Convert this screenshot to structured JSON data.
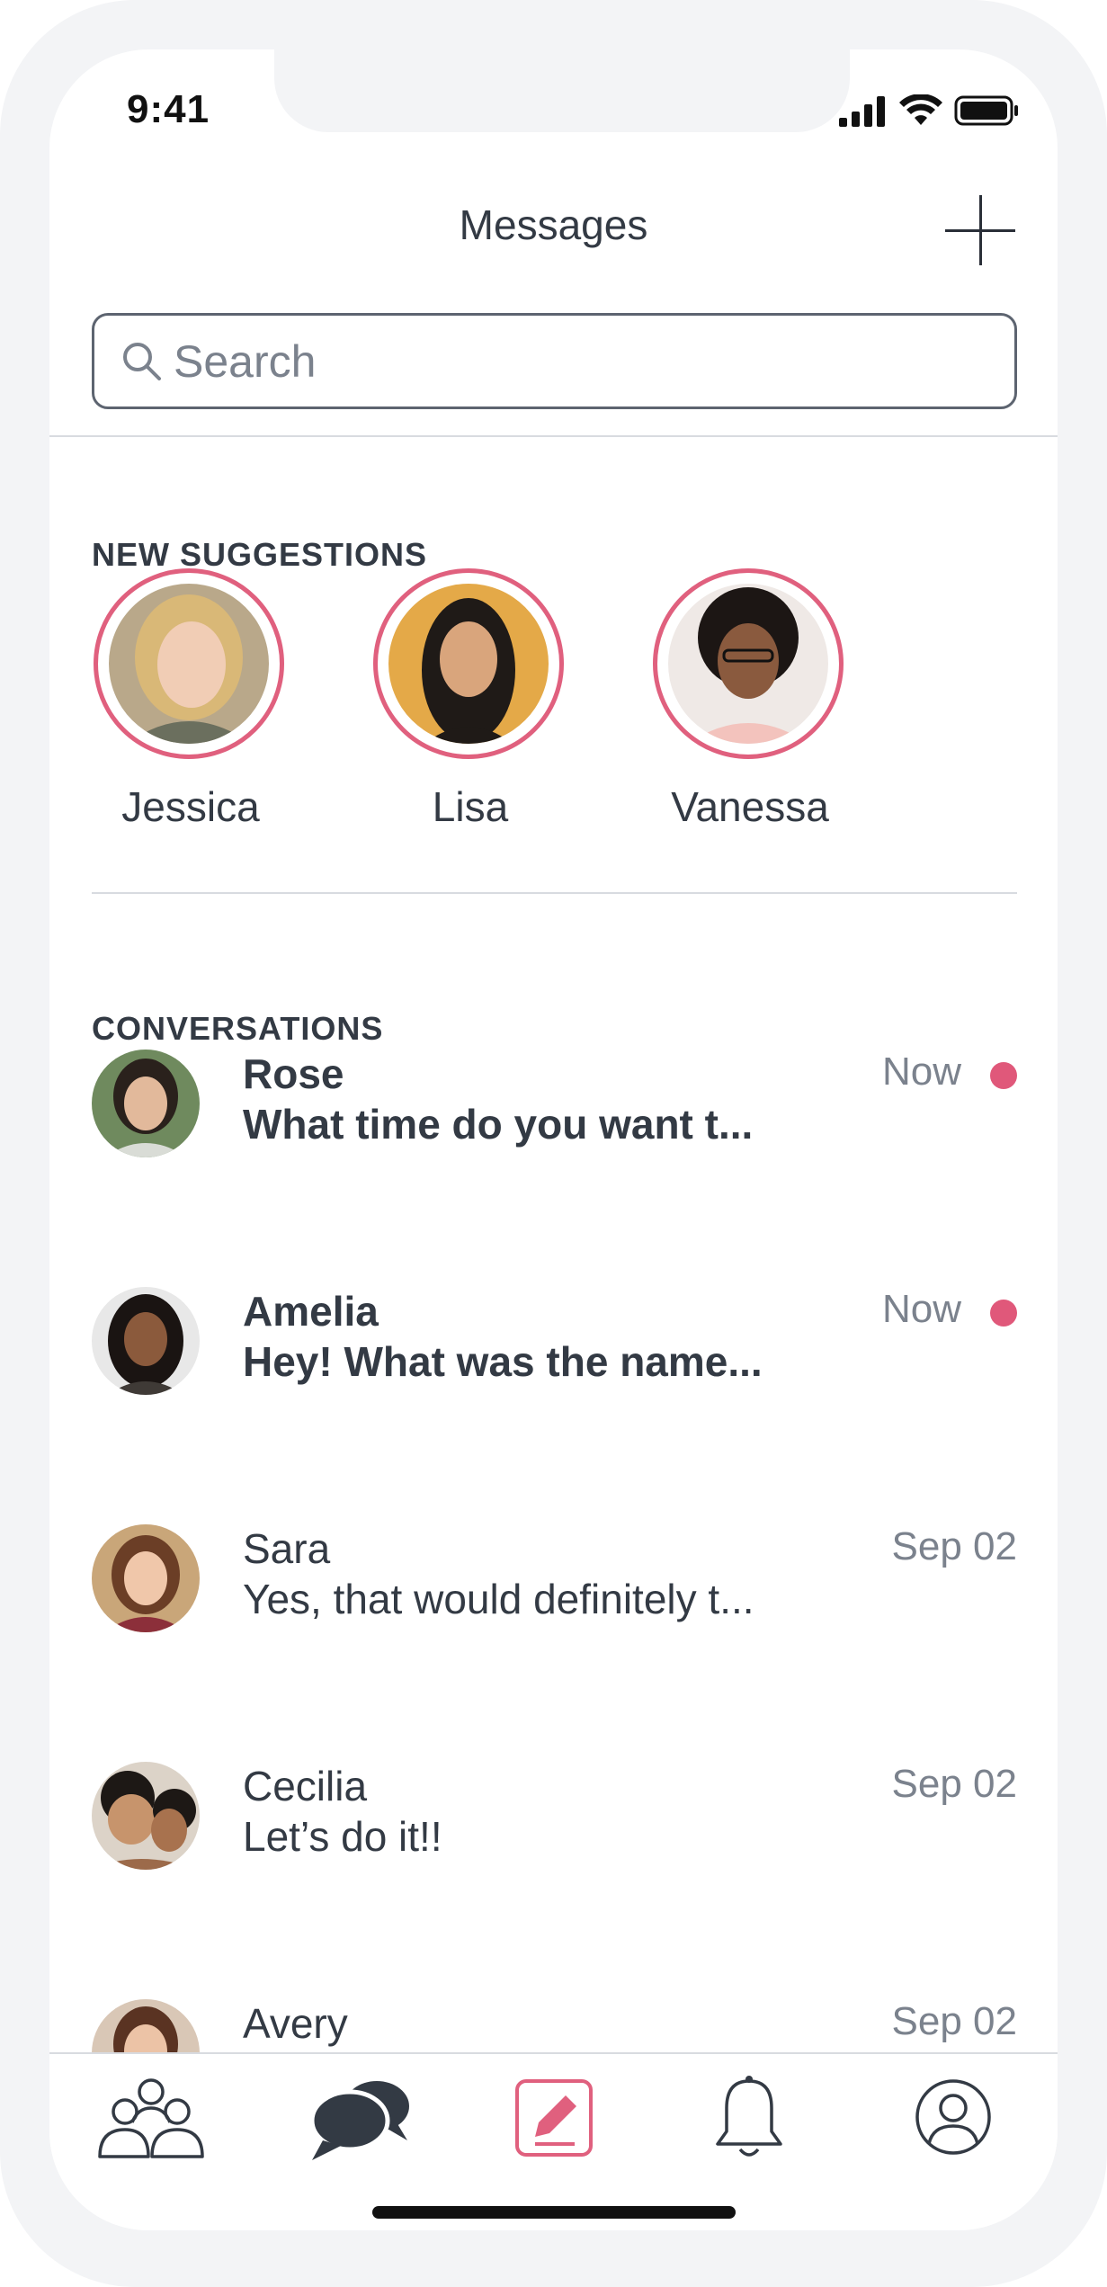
{
  "status_bar": {
    "time": "9:41"
  },
  "header": {
    "title": "Messages"
  },
  "search": {
    "placeholder": "Search"
  },
  "suggestions": {
    "title": "NEW SUGGESTIONS",
    "people": [
      {
        "name": "Jessica"
      },
      {
        "name": "Lisa"
      },
      {
        "name": "Vanessa"
      }
    ]
  },
  "conversations": {
    "title": "CONVERSATIONS",
    "items": [
      {
        "name": "Rose",
        "message": "What time do you want t...",
        "time": "Now",
        "unread": true
      },
      {
        "name": "Amelia",
        "message": "Hey! What was the name...",
        "time": "Now",
        "unread": true
      },
      {
        "name": "Sara",
        "message": "Yes, that would definitely t...",
        "time": "Sep 02",
        "unread": false
      },
      {
        "name": "Cecilia",
        "message": "Let’s do it!!",
        "time": "Sep 02",
        "unread": false
      },
      {
        "name": "Avery",
        "message": "",
        "time": "Sep 02",
        "unread": false
      }
    ]
  },
  "tab_bar": {
    "tabs": [
      {
        "icon": "people-icon"
      },
      {
        "icon": "chat-bubbles-icon"
      },
      {
        "icon": "compose-icon",
        "active": true
      },
      {
        "icon": "bell-icon"
      },
      {
        "icon": "profile-icon"
      }
    ]
  },
  "colors": {
    "accent": "#e0607e",
    "unread_dot": "#e0587a",
    "text": "#333a44",
    "muted": "#7b828d"
  }
}
